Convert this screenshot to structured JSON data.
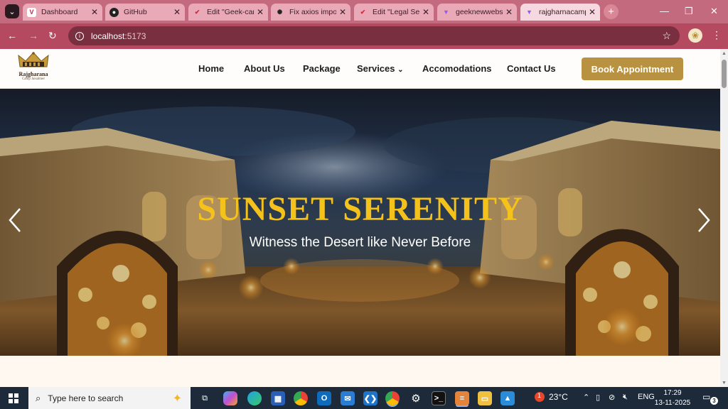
{
  "browser": {
    "tabs": [
      {
        "label": "Dashboard",
        "favicon": "vercel-icon"
      },
      {
        "label": "GitHub",
        "favicon": "github-icon"
      },
      {
        "label": "Edit \"Geek-camp\"",
        "favicon": "sanity-icon"
      },
      {
        "label": "Fix axios import",
        "favicon": "chatgpt-icon"
      },
      {
        "label": "Edit \"Legal Se",
        "favicon": "sanity-icon"
      },
      {
        "label": "geeknewwebsite",
        "favicon": "vite-icon"
      },
      {
        "label": "rajgharnacamp",
        "favicon": "vite-icon"
      }
    ],
    "tab_close": "✕",
    "new_tab": "+",
    "address": {
      "host": "localhost",
      "port": ":5173"
    }
  },
  "site": {
    "logo": {
      "name": "Rajgharana",
      "sub": "Camp Jaisalmer"
    },
    "nav": [
      "Home",
      "About Us",
      "Package",
      "Services",
      "Accomodations",
      "Contact Us"
    ],
    "cta": "Book Appointment",
    "hero": {
      "title": "SUNSET SERENITY",
      "subtitle": "Witness the Desert like Never Before"
    }
  },
  "taskbar": {
    "search_placeholder": "Type here to search",
    "weather": "23°C",
    "weather_badge": "1",
    "language": "ENG",
    "time": "17:29",
    "date": "13-11-2025",
    "notifications": "3"
  },
  "colors": {
    "accent_gold": "#b89240",
    "hero_title": "#f5c21b",
    "chrome_tab_strip": "#c46a7e",
    "chrome_toolbar": "#b5495f"
  }
}
